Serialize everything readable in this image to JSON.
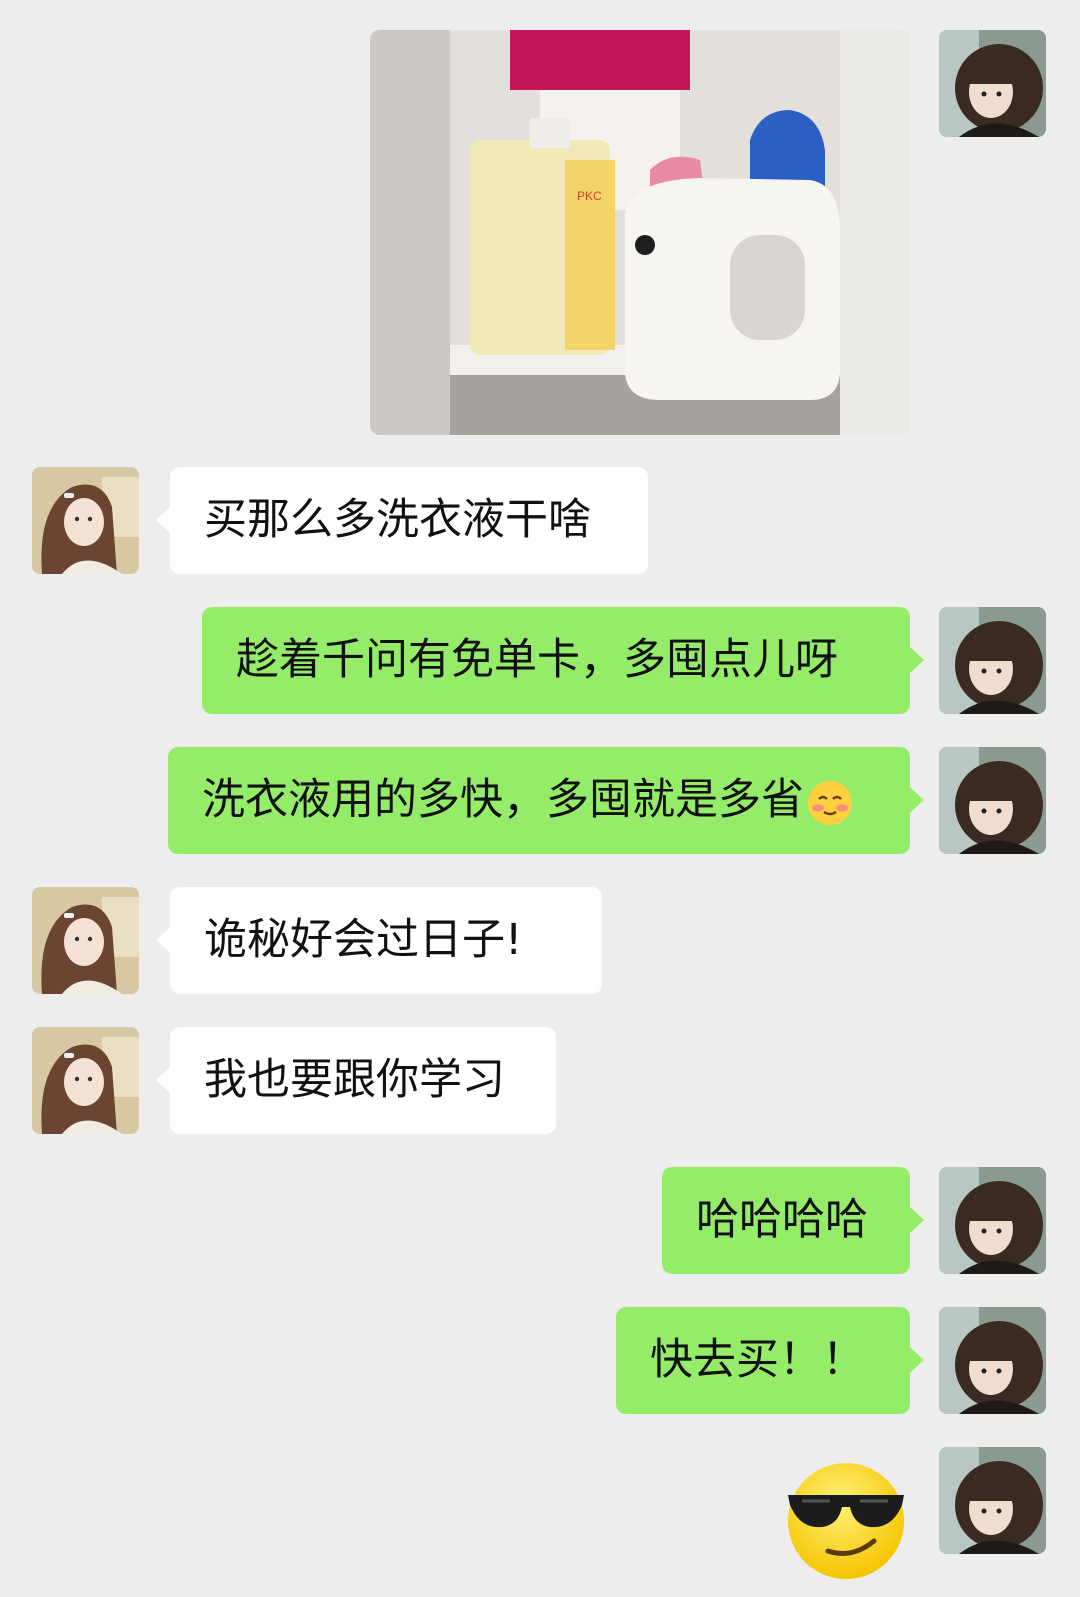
{
  "messages": [
    {
      "from": "me",
      "type": "image",
      "alt_icon": "photo-laundry-detergent-shelf"
    },
    {
      "from": "other",
      "type": "text",
      "text": "买那么多洗衣液干啥"
    },
    {
      "from": "me",
      "type": "text",
      "text": "趁着千问有免单卡，多囤点儿呀"
    },
    {
      "from": "me",
      "type": "text",
      "text": "洗衣液用的多快，多囤就是多省",
      "emoji": "blushing-smile-emoji"
    },
    {
      "from": "other",
      "type": "text",
      "text": "诡秘好会过日子!"
    },
    {
      "from": "other",
      "type": "text",
      "text": "我也要跟你学习"
    },
    {
      "from": "me",
      "type": "text",
      "text": "哈哈哈哈"
    },
    {
      "from": "me",
      "type": "text",
      "text": "快去买！！"
    },
    {
      "from": "me",
      "type": "sticker",
      "sticker": "sunglasses-smile-emoji"
    }
  ],
  "colors": {
    "background": "#ededed",
    "bubble_out": "#95ec69",
    "bubble_in": "#ffffff"
  },
  "bottle_label": {
    "brand": "PKC"
  }
}
